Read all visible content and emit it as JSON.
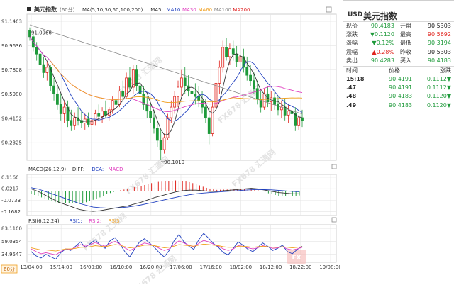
{
  "main_title": "美元指数",
  "period_badge": "60分",
  "ma_legend": [
    {
      "label": "MA(5,10,30,60,100,200)",
      "color": "#333333"
    },
    {
      "label": "MA5:",
      "color": "#333333"
    },
    {
      "label": "MA10",
      "color": "#1f3fbf"
    },
    {
      "label": "MA30",
      "color": "#e040c0"
    },
    {
      "label": "MA60",
      "color": "#f0a020"
    },
    {
      "label": "MA100",
      "color": "#888888"
    },
    {
      "label": "MA200",
      "color": "#e02020"
    }
  ],
  "macd_legend": [
    {
      "label": "MACD(26,12,9)",
      "color": "#333333"
    },
    {
      "label": "DIFF:",
      "color": "#333333"
    },
    {
      "label": "DEA:",
      "color": "#1f3fbf"
    },
    {
      "label": "MACD",
      "color": "#e040c0"
    }
  ],
  "rsi_legend": [
    {
      "label": "RSI(6,12,24)",
      "color": "#333333"
    },
    {
      "label": "RSI1:",
      "color": "#1f3fbf"
    },
    {
      "label": "RSI2:",
      "color": "#e040c0"
    },
    {
      "label": "RSI3",
      "color": "#f0a020"
    }
  ],
  "price_labels": [
    "91.1463",
    "90.9636",
    "90.7808",
    "90.5980",
    "90.4152",
    "90.2325"
  ],
  "high_marker": "91.0966",
  "low_marker": "90.1019",
  "macd_labels": [
    "0.1166",
    "0.0217",
    "-0.0733",
    "-0.1682"
  ],
  "rsi_labels": [
    "83.1160",
    "59.0354",
    "34.9547"
  ],
  "x_labels": [
    "13/04:00",
    "15/14:00",
    "16/00:00",
    "16/10:00",
    "16/20:00",
    "17/06:00",
    "17/16:00",
    "18/02:00",
    "18/12:00",
    "18/22:00",
    "19/08:00"
  ],
  "watermark": "FX678 汇通网",
  "panel": {
    "symbol": "USD",
    "name": "美元指数",
    "rows": [
      {
        "l1": "现价",
        "v1": "90.4183",
        "c1": "green",
        "l2": "开盘",
        "v2": "90.5303",
        "c2": "black"
      },
      {
        "l1": "涨跌",
        "v1": "▼0.1120",
        "c1": "green",
        "l2": "最高",
        "v2": "90.5692",
        "c2": "red"
      },
      {
        "l1": "涨幅",
        "v1": "▼0.12%",
        "c1": "green",
        "l2": "最低",
        "v2": "90.3194",
        "c2": "green"
      },
      {
        "l1": "震幅",
        "v1": "▲0.28%",
        "c1": "red",
        "l2": "昨收",
        "v2": "90.5303",
        "c2": "black"
      },
      {
        "l1": "卖出",
        "v1": "90.4283",
        "c1": "green",
        "l2": "买入",
        "v2": "90.4183",
        "c2": "green"
      }
    ],
    "ticks_header": {
      "time": "时间",
      "price": "价格",
      "change": "涨跌"
    },
    "ticks": [
      {
        "time": "15:18",
        "price": "90.4191",
        "change": "0.1112▼"
      },
      {
        "time": ".47",
        "price": "90.4191",
        "change": "0.1112▼"
      },
      {
        "time": ".48",
        "price": "90.4183",
        "change": "0.1120▼"
      },
      {
        "time": ".49",
        "price": "90.4183",
        "change": "0.1120▼"
      }
    ]
  },
  "colors": {
    "up": "#e0241d",
    "down": "#1e9a3a",
    "grid": "#e4e4e4"
  },
  "chart_data": [
    {
      "type": "candlestick",
      "title": "美元指数",
      "ylim": [
        90.1,
        91.2
      ],
      "y_ticks": [
        91.1463,
        90.9636,
        90.7808,
        90.598,
        90.4152,
        90.2325
      ],
      "x_tick_labels": [
        "13/04:00",
        "15/14:00",
        "16/00:00",
        "16/10:00",
        "16/20:00",
        "17/06:00",
        "17/16:00",
        "18/02:00",
        "18/12:00",
        "18/22:00",
        "19/08:00"
      ],
      "grid": true,
      "annotations": [
        {
          "text": "91.0966"
        },
        {
          "text": "90.1019"
        }
      ],
      "ohlc": [
        [
          91.08,
          91.1,
          91.0,
          91.03
        ],
        [
          91.03,
          91.05,
          90.92,
          90.95
        ],
        [
          90.95,
          90.99,
          90.85,
          90.9
        ],
        [
          90.9,
          90.95,
          90.8,
          90.82
        ],
        [
          90.82,
          90.88,
          90.72,
          90.76
        ],
        [
          90.76,
          90.84,
          90.7,
          90.8
        ],
        [
          90.8,
          90.82,
          90.62,
          90.66
        ],
        [
          90.66,
          90.72,
          90.55,
          90.6
        ],
        [
          90.6,
          90.65,
          90.48,
          90.52
        ],
        [
          90.52,
          90.6,
          90.4,
          90.45
        ],
        [
          90.45,
          90.55,
          90.38,
          90.5
        ],
        [
          90.5,
          90.55,
          90.35,
          90.4
        ],
        [
          90.4,
          90.48,
          90.32,
          90.36
        ],
        [
          90.36,
          90.46,
          90.33,
          90.42
        ],
        [
          90.42,
          90.5,
          90.36,
          90.4
        ],
        [
          90.4,
          90.47,
          90.34,
          90.38
        ],
        [
          90.38,
          90.45,
          90.33,
          90.41
        ],
        [
          90.41,
          90.46,
          90.35,
          90.37
        ],
        [
          90.37,
          90.44,
          90.33,
          90.4
        ],
        [
          90.4,
          90.48,
          90.36,
          90.45
        ],
        [
          90.45,
          90.52,
          90.4,
          90.43
        ],
        [
          90.43,
          90.5,
          90.38,
          90.47
        ],
        [
          90.47,
          90.55,
          90.42,
          90.44
        ],
        [
          90.44,
          90.5,
          90.4,
          90.48
        ],
        [
          90.48,
          90.58,
          90.45,
          90.55
        ],
        [
          90.55,
          90.62,
          90.48,
          90.52
        ],
        [
          90.52,
          90.66,
          90.5,
          90.62
        ],
        [
          90.62,
          90.7,
          90.55,
          90.58
        ],
        [
          90.58,
          90.76,
          90.56,
          90.72
        ],
        [
          90.72,
          90.8,
          90.62,
          90.65
        ],
        [
          90.65,
          90.82,
          90.6,
          90.78
        ],
        [
          90.78,
          90.82,
          90.62,
          90.66
        ],
        [
          90.66,
          90.72,
          90.55,
          90.6
        ],
        [
          90.6,
          90.66,
          90.48,
          90.52
        ],
        [
          90.52,
          90.58,
          90.42,
          90.47
        ],
        [
          90.47,
          90.53,
          90.38,
          90.42
        ],
        [
          90.42,
          90.48,
          90.3,
          90.34
        ],
        [
          90.34,
          90.4,
          90.2,
          90.25
        ],
        [
          90.25,
          90.33,
          90.1,
          90.18
        ],
        [
          90.18,
          90.3,
          90.15,
          90.27
        ],
        [
          90.27,
          90.45,
          90.25,
          90.42
        ],
        [
          90.42,
          90.55,
          90.38,
          90.5
        ],
        [
          90.5,
          90.62,
          90.45,
          90.58
        ],
        [
          90.58,
          90.7,
          90.5,
          90.65
        ],
        [
          90.65,
          90.78,
          90.58,
          90.72
        ],
        [
          90.72,
          90.8,
          90.6,
          90.66
        ],
        [
          90.66,
          90.74,
          90.58,
          90.62
        ],
        [
          90.62,
          90.7,
          90.55,
          90.6
        ],
        [
          90.6,
          90.68,
          90.52,
          90.58
        ],
        [
          90.58,
          90.66,
          90.5,
          90.55
        ],
        [
          90.55,
          90.62,
          90.45,
          90.5
        ],
        [
          90.5,
          90.56,
          90.38,
          90.42
        ],
        [
          90.42,
          90.5,
          90.22,
          90.3
        ],
        [
          90.3,
          90.55,
          90.28,
          90.5
        ],
        [
          90.5,
          90.72,
          90.46,
          90.68
        ],
        [
          90.68,
          90.85,
          90.6,
          90.8
        ],
        [
          90.8,
          91.0,
          90.76,
          90.95
        ],
        [
          90.95,
          91.02,
          90.85,
          90.88
        ],
        [
          90.88,
          90.98,
          90.82,
          90.94
        ],
        [
          90.94,
          91.0,
          90.85,
          90.9
        ],
        [
          90.9,
          90.96,
          90.8,
          90.84
        ],
        [
          90.84,
          90.92,
          90.78,
          90.88
        ],
        [
          90.88,
          90.94,
          90.76,
          90.8
        ],
        [
          90.8,
          90.88,
          90.7,
          90.74
        ],
        [
          90.74,
          90.82,
          90.66,
          90.7
        ],
        [
          90.7,
          90.76,
          90.6,
          90.64
        ],
        [
          90.64,
          90.7,
          90.52,
          90.56
        ],
        [
          90.56,
          90.62,
          90.46,
          90.5
        ],
        [
          90.5,
          90.64,
          90.48,
          90.6
        ],
        [
          90.6,
          90.66,
          90.5,
          90.54
        ],
        [
          90.54,
          90.62,
          90.47,
          90.57
        ],
        [
          90.57,
          90.61,
          90.48,
          90.52
        ],
        [
          90.52,
          90.58,
          90.44,
          90.48
        ],
        [
          90.48,
          90.55,
          90.42,
          90.5
        ],
        [
          90.5,
          90.56,
          90.4,
          90.44
        ],
        [
          90.44,
          90.52,
          90.38,
          90.47
        ],
        [
          90.47,
          90.55,
          90.4,
          90.45
        ],
        [
          90.45,
          90.5,
          90.32,
          90.36
        ],
        [
          90.36,
          90.44,
          90.33,
          90.42
        ],
        [
          90.42,
          90.48,
          90.35,
          90.4
        ]
      ]
    },
    {
      "type": "line",
      "title": "MACD(26,12,9)",
      "ylim": [
        -0.2,
        0.14
      ],
      "y_ticks": [
        0.1166,
        0.0217,
        -0.0733,
        -0.1682
      ],
      "series": [
        {
          "name": "DIFF",
          "values": [
            0.02,
            0.0,
            -0.03,
            -0.06,
            -0.09,
            -0.11,
            -0.13,
            -0.15,
            -0.16,
            -0.165,
            -0.16,
            -0.15,
            -0.14,
            -0.13,
            -0.12,
            -0.105,
            -0.09,
            -0.07,
            -0.05,
            -0.035,
            -0.02,
            -0.005,
            0.005,
            0.01,
            0.01,
            0.005,
            0.0,
            0.0,
            0.005,
            0.01,
            0.015,
            0.02,
            0.025,
            0.02,
            0.01,
            0.0,
            -0.01,
            -0.015,
            -0.02,
            -0.02
          ]
        },
        {
          "name": "DEA",
          "values": [
            0.03,
            0.02,
            0.0,
            -0.02,
            -0.04,
            -0.06,
            -0.08,
            -0.1,
            -0.115,
            -0.13,
            -0.135,
            -0.138,
            -0.138,
            -0.135,
            -0.13,
            -0.122,
            -0.112,
            -0.1,
            -0.088,
            -0.075,
            -0.062,
            -0.05,
            -0.038,
            -0.028,
            -0.02,
            -0.014,
            -0.01,
            -0.006,
            -0.002,
            0.002,
            0.006,
            0.01,
            0.013,
            0.015,
            0.014,
            0.012,
            0.008,
            0.004,
            0.0,
            -0.003
          ]
        },
        {
          "name": "MACD",
          "values": [
            -0.02,
            -0.04,
            -0.06,
            -0.08,
            -0.1,
            -0.1,
            -0.1,
            -0.1,
            -0.09,
            -0.07,
            -0.05,
            -0.024,
            -0.004,
            0.01,
            0.02,
            0.034,
            0.044,
            0.06,
            0.076,
            0.08,
            0.084,
            0.09,
            0.086,
            0.076,
            0.06,
            0.038,
            0.02,
            0.012,
            0.014,
            0.016,
            0.018,
            0.02,
            0.024,
            0.01,
            -0.008,
            -0.024,
            -0.036,
            -0.038,
            -0.04,
            -0.034
          ]
        }
      ]
    },
    {
      "type": "line",
      "title": "RSI(6,12,24)",
      "ylim": [
        20,
        90
      ],
      "y_ticks": [
        83.116,
        59.0354,
        34.9547
      ],
      "series": [
        {
          "name": "RSI1",
          "values": [
            40,
            32,
            28,
            35,
            30,
            26,
            38,
            45,
            42,
            50,
            58,
            48,
            55,
            62,
            52,
            46,
            60,
            66,
            54,
            40,
            30,
            45,
            58,
            64,
            56,
            48,
            38,
            30,
            42,
            60,
            72,
            58,
            50,
            44,
            62,
            74,
            65,
            55,
            48,
            38,
            34,
            46,
            58,
            52,
            44,
            40,
            48,
            56,
            50,
            42,
            46,
            52,
            40,
            36,
            44,
            50
          ]
        },
        {
          "name": "RSI2",
          "values": [
            45,
            40,
            36,
            38,
            36,
            34,
            40,
            45,
            44,
            48,
            53,
            50,
            53,
            57,
            53,
            50,
            55,
            59,
            54,
            47,
            42,
            46,
            52,
            56,
            54,
            51,
            46,
            42,
            45,
            53,
            60,
            56,
            52,
            49,
            55,
            61,
            58,
            54,
            50,
            45,
            42,
            45,
            51,
            50,
            47,
            45,
            47,
            51,
            49,
            46,
            47,
            49,
            45,
            43,
            45,
            48
          ]
        },
        {
          "name": "RSI3",
          "values": [
            47,
            45,
            43,
            43,
            42,
            41,
            43,
            45,
            45,
            46,
            48,
            48,
            49,
            51,
            50,
            49,
            51,
            53,
            52,
            49,
            47,
            48,
            50,
            52,
            52,
            51,
            49,
            47,
            48,
            50,
            53,
            52,
            51,
            50,
            52,
            54,
            53,
            52,
            51,
            49,
            48,
            48,
            50,
            50,
            49,
            48,
            49,
            50,
            49,
            48,
            48,
            49,
            48,
            47,
            48,
            49
          ]
        }
      ]
    }
  ]
}
